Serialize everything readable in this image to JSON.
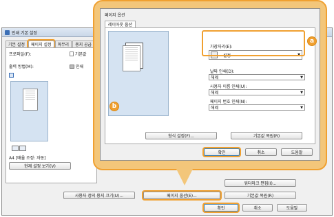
{
  "background_window": {
    "title": "인쇄 기본 설정",
    "tabs": [
      "기본 설정",
      "페이지 설정",
      "마무리",
      "용지 공급"
    ],
    "profile_label": "프로파일(F):",
    "profile_value": "기본값",
    "output_label": "출력 방법(M):",
    "output_value": "인쇄",
    "scale_text": "A4 [배율 조정: 자동]",
    "view_settings_button": "현재 설정 보기(V)",
    "custom_paper_button": "사용자 정의 용지 크기(U)...",
    "page_options_button": "페이지 옵션(E)...",
    "watermark_button": "워터마크 편집(I)...",
    "restore_defaults_button": "기본값 복원(R)",
    "ok_button": "확인",
    "cancel_button": "취소",
    "help_button": "도움말"
  },
  "dialog": {
    "title": "페이지 옵션",
    "tab": "레이아웃 옵션",
    "binding_label": "가장자리(E):",
    "binding_value": "설정",
    "date_print_label": "날짜 인쇄(D):",
    "date_print_value": "해제",
    "user_name_print_label": "사용자 이름 인쇄(U):",
    "user_name_print_value": "해제",
    "page_number_print_label": "페이지 번호 인쇄(N):",
    "page_number_print_value": "해제",
    "format_settings_button": "형식 설정(F)...",
    "restore_defaults_button": "기본값 복원(R)",
    "ok_button": "확인",
    "cancel_button": "취소",
    "help_button": "도움말"
  },
  "badges": {
    "a": "a",
    "b": "b"
  },
  "colors": {
    "highlight": "#f0a030",
    "callout_fill": "#f3c67a",
    "preview_bg": "#d5e3f2"
  },
  "icons": [
    "printer-icon",
    "page-preview-icon",
    "dropdown-arrow-icon",
    "layout-icons"
  ]
}
